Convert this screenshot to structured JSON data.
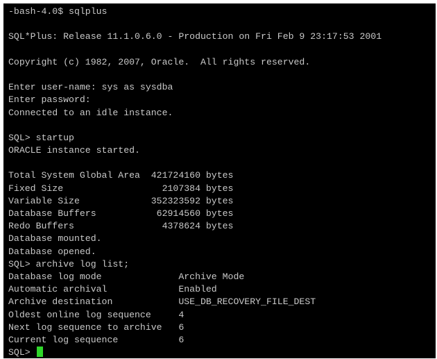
{
  "colors": {
    "terminal_background": "#000000",
    "terminal_text": "#c9c9c9",
    "cursor": "#2fd62a"
  },
  "terminal": {
    "lines": [
      "-bash-4.0$ sqlplus",
      "",
      "SQL*Plus: Release 11.1.0.6.0 - Production on Fri Feb 9 23:17:53 2001",
      "",
      "Copyright (c) 1982, 2007, Oracle.  All rights reserved.",
      "",
      "Enter user-name: sys as sysdba",
      "Enter password:",
      "Connected to an idle instance.",
      "",
      "SQL> startup",
      "ORACLE instance started.",
      "",
      "Total System Global Area  421724160 bytes",
      "Fixed Size                  2107384 bytes",
      "Variable Size             352323592 bytes",
      "Database Buffers           62914560 bytes",
      "Redo Buffers                4378624 bytes",
      "Database mounted.",
      "Database opened.",
      "SQL> archive log list;",
      "Database log mode              Archive Mode",
      "Automatic archival             Enabled",
      "Archive destination            USE_DB_RECOVERY_FILE_DEST",
      "Oldest online log sequence     4",
      "Next log sequence to archive   6",
      "Current log sequence           6"
    ],
    "prompt": "SQL> "
  }
}
